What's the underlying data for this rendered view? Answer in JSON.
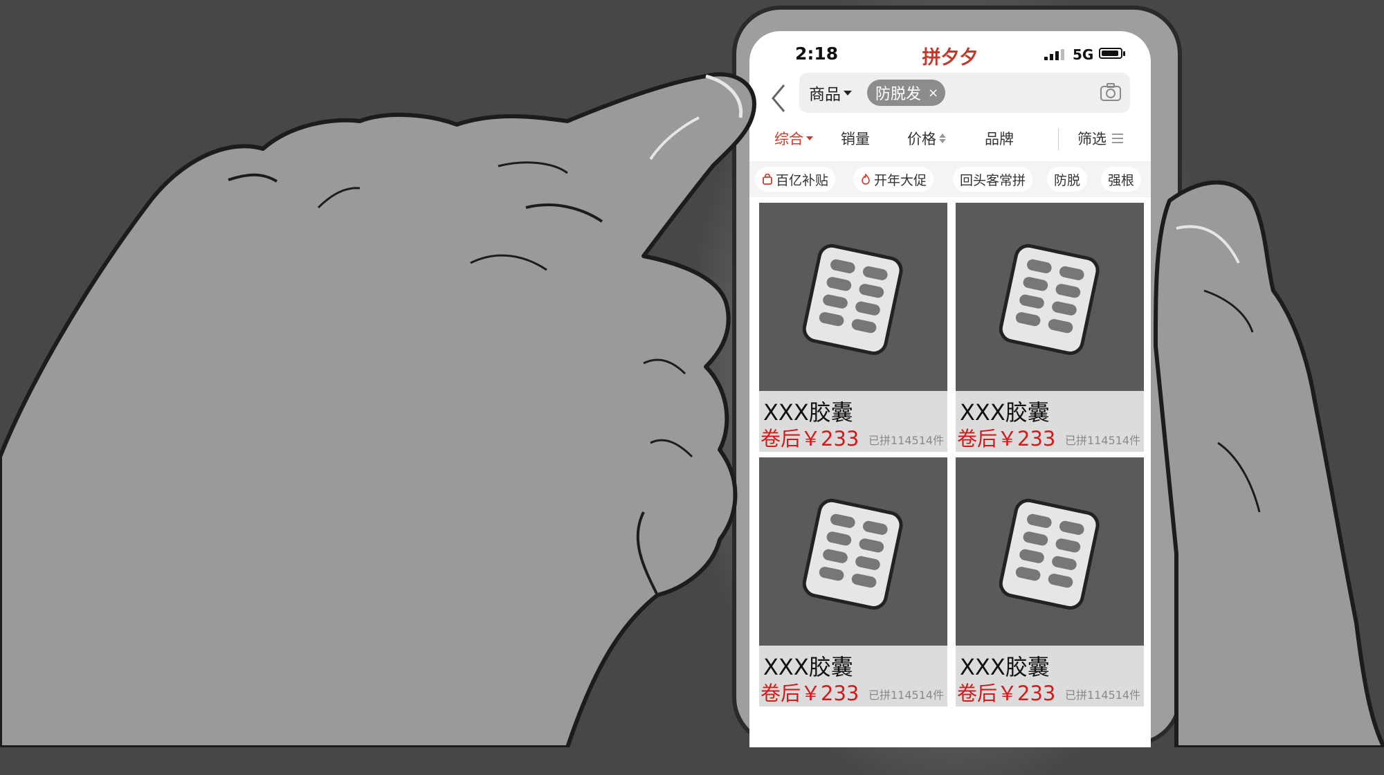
{
  "status_bar": {
    "time": "2:18",
    "app_title": "拼夕夕",
    "network": "5G"
  },
  "search": {
    "scope_label": "商品",
    "tag_label": "防脱发",
    "tag_close": "×"
  },
  "sort_bar": {
    "items": [
      "综合",
      "销量",
      "价格",
      "品牌",
      "筛选"
    ],
    "active": "综合"
  },
  "chips": [
    "百亿补贴",
    "开年大促",
    "回头客常拼",
    "防脱",
    "强根"
  ],
  "products": [
    {
      "name": "XXX胶囊",
      "price": "卷后￥233",
      "sold": "已拼114514件"
    },
    {
      "name": "XXX胶囊",
      "price": "卷后￥233",
      "sold": "已拼114514件"
    },
    {
      "name": "XXX胶囊",
      "price": "卷后￥233",
      "sold": "已拼114514件"
    },
    {
      "name": "XXX胶囊",
      "price": "卷后￥233",
      "sold": "已拼114514件"
    }
  ],
  "colors": {
    "accent": "#d0392b",
    "price": "#d11b1b",
    "background": "#474747"
  }
}
